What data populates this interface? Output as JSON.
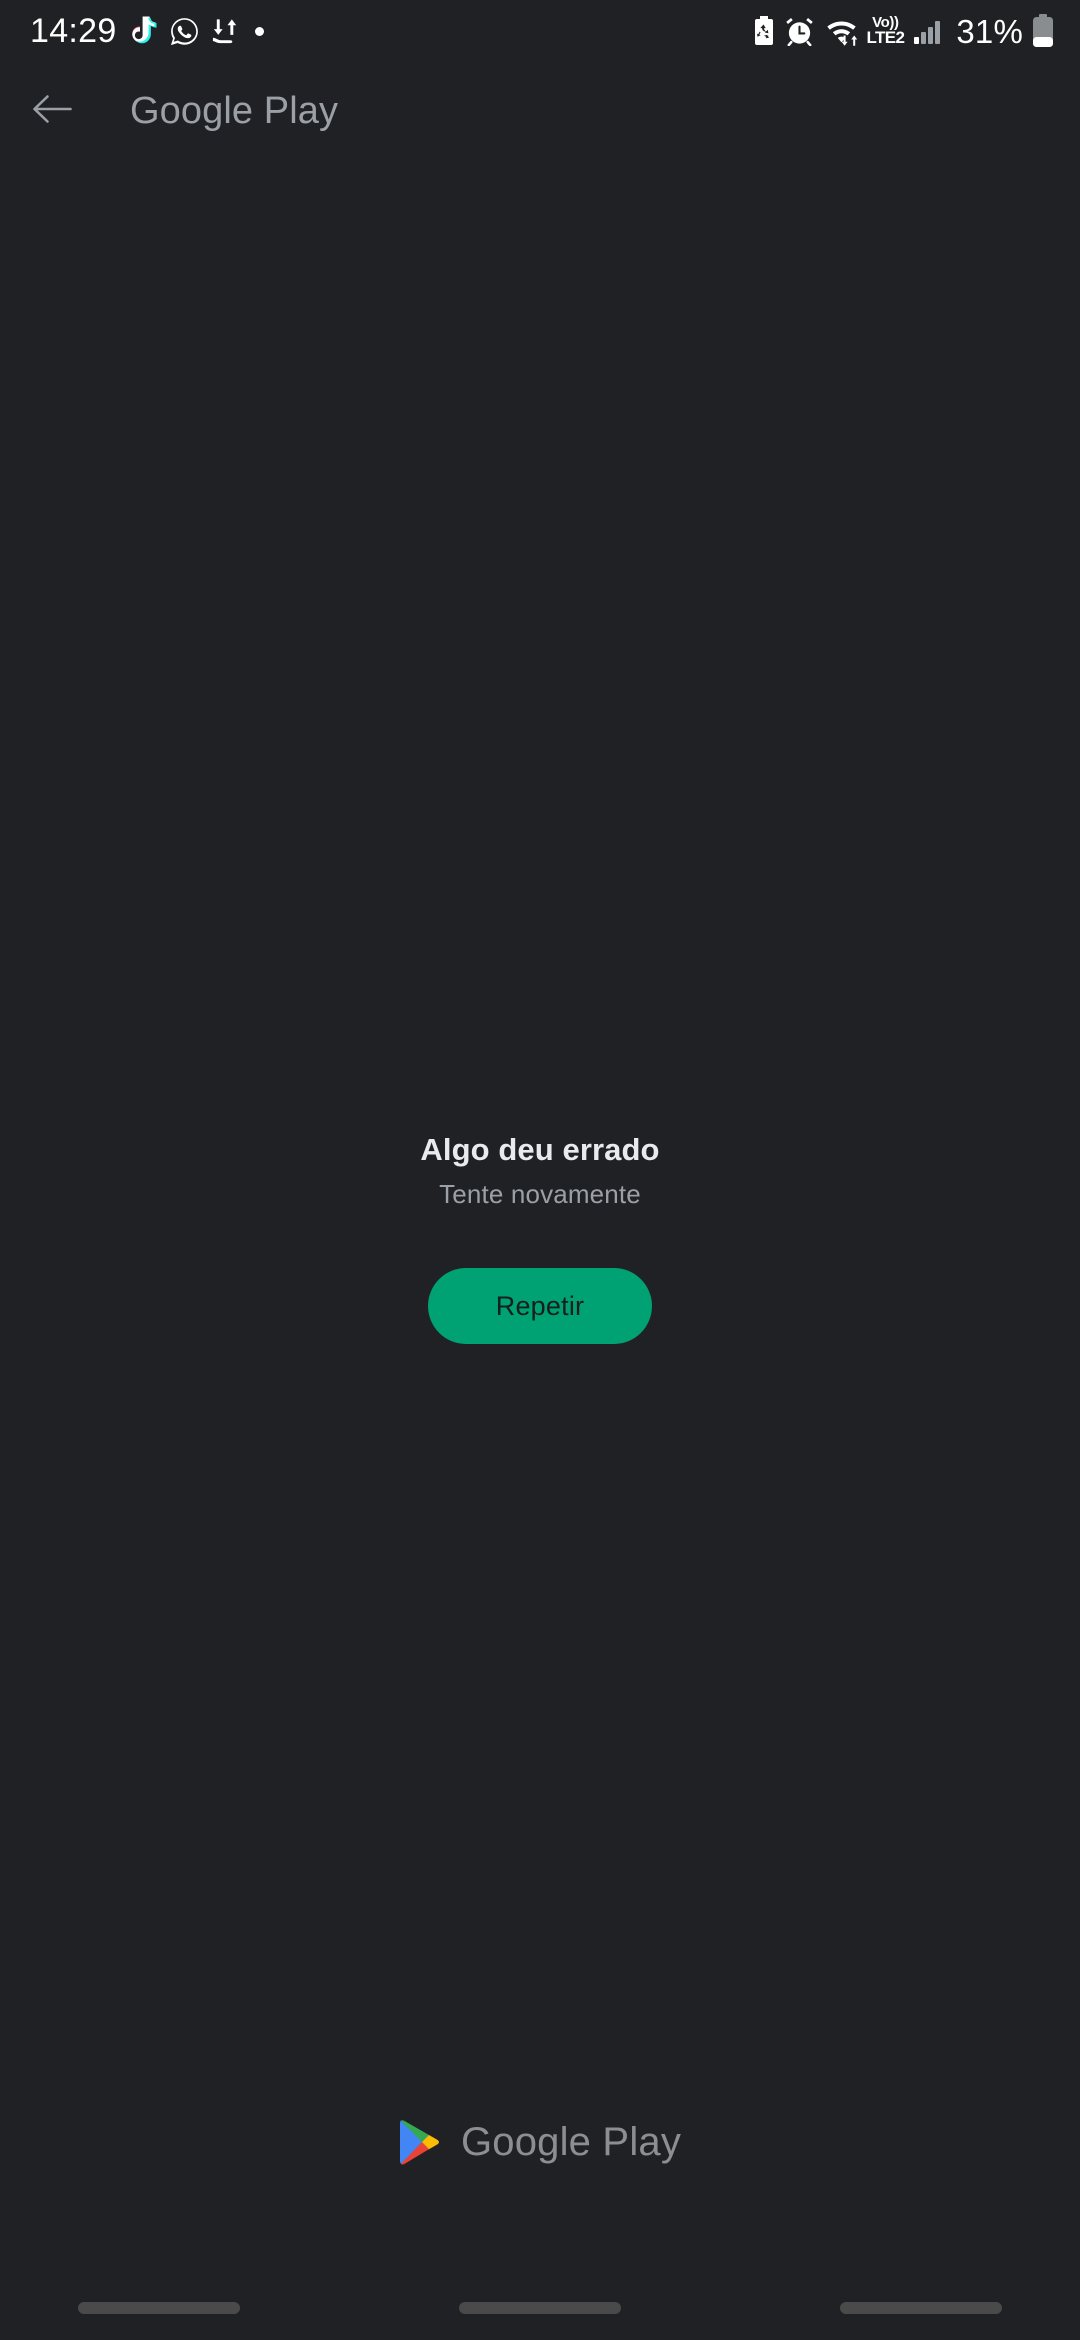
{
  "theme": {
    "background": "#202124",
    "accent_green": "#00A173",
    "text_primary": "#e8eaed",
    "text_secondary": "#9aa0a6",
    "nav_pill": "#4a4a4a"
  },
  "status_bar": {
    "clock": "14:29",
    "left_icons": [
      {
        "name": "tiktok-icon",
        "label": "TikTok"
      },
      {
        "name": "whatsapp-icon",
        "label": "WhatsApp"
      },
      {
        "name": "data-transfer-icon",
        "label": "Data transfer"
      },
      {
        "name": "notification-dot-icon",
        "label": "More notifications"
      }
    ],
    "right_icons": [
      {
        "name": "battery-saver-icon",
        "label": "Battery saver"
      },
      {
        "name": "alarm-icon",
        "label": "Alarm set"
      },
      {
        "name": "wifi-icon",
        "label": "Wi-Fi with data activity"
      },
      {
        "name": "volte-icon",
        "label": "VoLTE2"
      },
      {
        "name": "signal-bars-icon",
        "label": "Mobile signal"
      },
      {
        "name": "battery-icon",
        "label": "Battery"
      }
    ],
    "volte_top": "Vo))",
    "volte_bottom": "LTE2",
    "battery_percent": "31%"
  },
  "app_bar": {
    "back_icon": "arrow-back-icon",
    "title": "Google Play"
  },
  "main": {
    "error_title": "Algo deu errado",
    "error_subtitle": "Tente novamente",
    "retry_button_label": "Repetir"
  },
  "footer": {
    "logo_icon": "google-play-logo-icon",
    "logo_text": "Google Play"
  },
  "nav_bar": {
    "recents_label": "Recents",
    "home_label": "Home",
    "back_label": "Back"
  }
}
